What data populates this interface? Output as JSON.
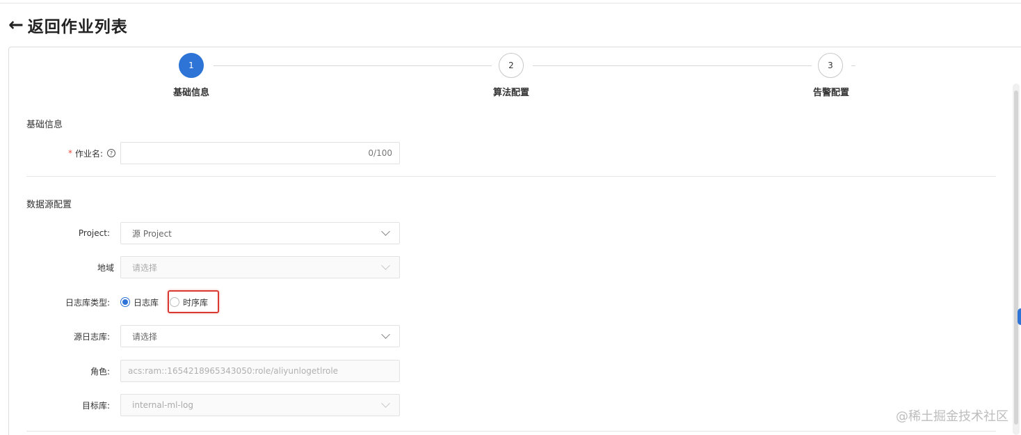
{
  "header": {
    "back_arrow": "←",
    "back_label": "返回作业列表"
  },
  "steps": [
    {
      "number": "1",
      "label": "基础信息",
      "state": "active"
    },
    {
      "number": "2",
      "label": "算法配置",
      "state": "inactive"
    },
    {
      "number": "3",
      "label": "告警配置",
      "state": "inactive"
    }
  ],
  "basic_section": {
    "title": "基础信息",
    "job_name": {
      "required_mark": "*",
      "label": "作业名:",
      "help_icon": "question-circle-icon",
      "value": "",
      "counter": "0/100"
    }
  },
  "datasource_section": {
    "title": "数据源配置",
    "project": {
      "label": "Project:",
      "value": "源 Project"
    },
    "region": {
      "label": "地域",
      "placeholder": "请选择"
    },
    "logstore_type": {
      "label": "日志库类型:",
      "options": [
        {
          "label": "日志库",
          "checked": true
        },
        {
          "label": "时序库",
          "checked": false
        }
      ]
    },
    "source_logstore": {
      "label": "源日志库:",
      "placeholder": "请选择"
    },
    "role": {
      "label": "角色:",
      "value": "acs:ram::1654218965343050:role/aliyunlogetlrole"
    },
    "target_store": {
      "label": "目标库:",
      "value": "internal-ml-log"
    }
  },
  "watermark": "@稀土掘金技术社区",
  "colors": {
    "primary": "#2d74d6",
    "required": "#e5483b",
    "highlight": "#d83a32"
  }
}
